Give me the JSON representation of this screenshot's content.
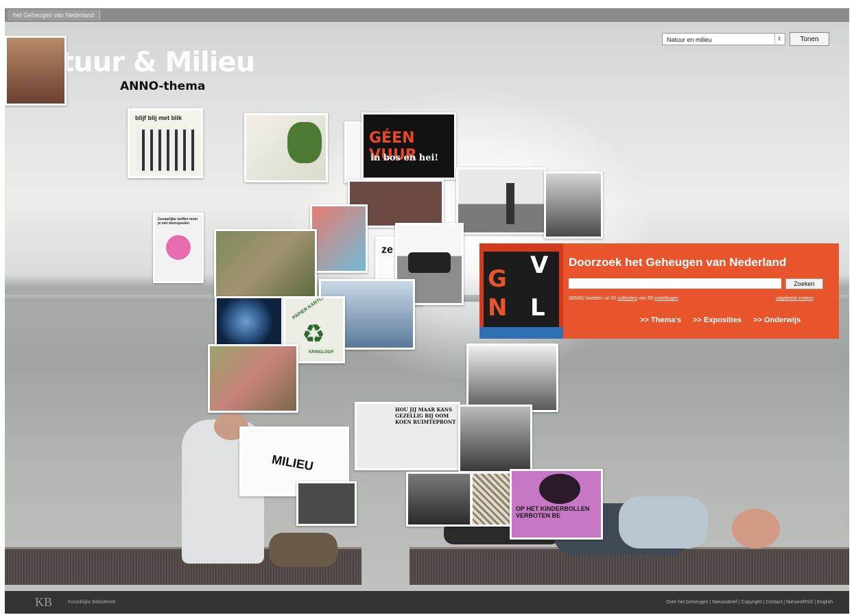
{
  "topbar": {
    "tab_label": "het Geheugen van Nederland"
  },
  "header": {
    "title": "tuur & Milieu",
    "subtitle": "ANNO-thema"
  },
  "theme_select": {
    "selected": "Natuur en milieu",
    "button_label": "Tonen"
  },
  "tiles": {
    "blij": "blijf blij met blik",
    "geen_vuur_1": "GÉEN VUUR",
    "geen_vuur_2": "in bos en hei!",
    "gevaarlijk": "Gevaarlijke stoffen moet je niet doorspoelen",
    "papier_karton": "PAPIER KARTON",
    "recycle": "KRINGLOOP",
    "zee": "ze te",
    "milieu": "MILIEU",
    "comic": "HOU JIJ MAAR KANS GEZELLIG BIJ OOM KOEN RUIMTEPRONT",
    "pink": "OP HET KINDERBOLLEN VERBOTEN BE"
  },
  "search": {
    "logo_letters": [
      "G",
      "V",
      "N",
      "L"
    ],
    "heading": "Doorzoek het Geheugen van Nederland",
    "button_label": "Zoeken",
    "stats_prefix": "365052 beelden uit 62",
    "stats_link1": "collecties",
    "stats_mid": "van 58",
    "stats_link2": "instellingen",
    "advanced": "uitgebreid zoeken",
    "nav": [
      ">> Thema's",
      ">> Exposities",
      ">> Onderwijs"
    ]
  },
  "footer": {
    "logo": "KB",
    "org": "Koninklijke Bibliotheek",
    "links": "Over het Geheugen | Nieuwsbrief | Copyright | Contact | Nieuws/RSS | English"
  }
}
